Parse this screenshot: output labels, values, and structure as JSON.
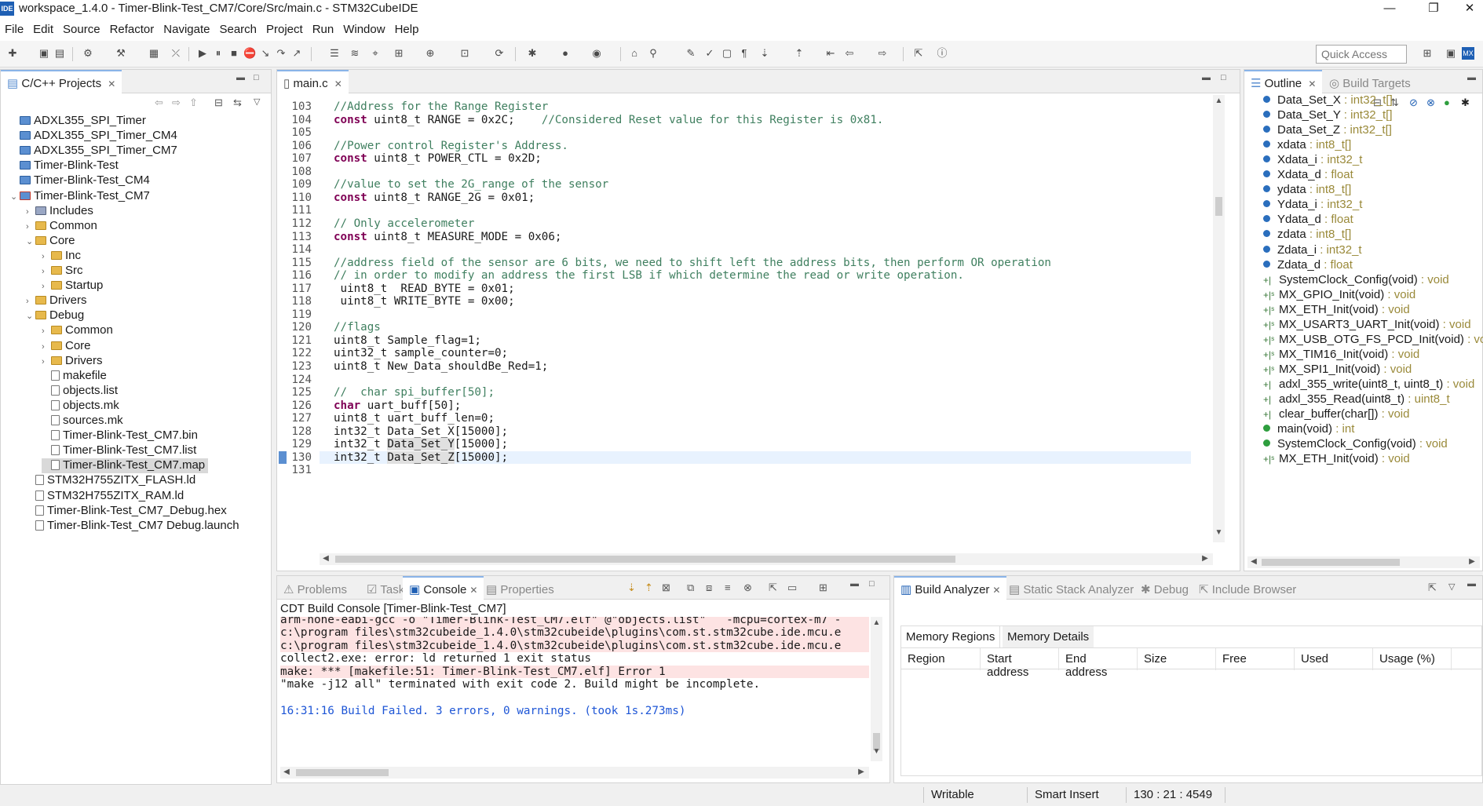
{
  "titlebar": {
    "app_icon": "IDE",
    "title": "workspace_1.4.0 - Timer-Blink-Test_CM7/Core/Src/main.c - STM32CubeIDE",
    "minimize": "—",
    "restore": "❐",
    "close": "✕"
  },
  "menu": [
    "File",
    "Edit",
    "Source",
    "Refactor",
    "Navigate",
    "Search",
    "Project",
    "Run",
    "Window",
    "Help"
  ],
  "toolbar": {
    "quick_access_placeholder": "Quick Access"
  },
  "projects_panel": {
    "tab_label": "C/C++ Projects",
    "tree": [
      {
        "label": "ADXL355_SPI_Timer",
        "icon": "project",
        "arrow": "",
        "indent": 0
      },
      {
        "label": "ADXL355_SPI_Timer_CM4",
        "icon": "project",
        "arrow": "",
        "indent": 0
      },
      {
        "label": "ADXL355_SPI_Timer_CM7",
        "icon": "project",
        "arrow": "",
        "indent": 0
      },
      {
        "label": "Timer-Blink-Test",
        "icon": "project",
        "arrow": "",
        "indent": 0
      },
      {
        "label": "Timer-Blink-Test_CM4",
        "icon": "project",
        "arrow": "",
        "indent": 0
      },
      {
        "label": "Timer-Blink-Test_CM7",
        "icon": "project-multi",
        "arrow": "v",
        "indent": 0
      },
      {
        "label": "Includes",
        "icon": "includes",
        "arrow": ">",
        "indent": 1
      },
      {
        "label": "Common",
        "icon": "folder",
        "arrow": ">",
        "indent": 1
      },
      {
        "label": "Core",
        "icon": "folder",
        "arrow": "v",
        "indent": 1
      },
      {
        "label": "Inc",
        "icon": "folder",
        "arrow": ">",
        "indent": 2
      },
      {
        "label": "Src",
        "icon": "folder",
        "arrow": ">",
        "indent": 2
      },
      {
        "label": "Startup",
        "icon": "folder",
        "arrow": ">",
        "indent": 2
      },
      {
        "label": "Drivers",
        "icon": "folder",
        "arrow": ">",
        "indent": 1
      },
      {
        "label": "Debug",
        "icon": "folder",
        "arrow": "v",
        "indent": 1
      },
      {
        "label": "Common",
        "icon": "folder",
        "arrow": ">",
        "indent": 2
      },
      {
        "label": "Core",
        "icon": "folder",
        "arrow": ">",
        "indent": 2
      },
      {
        "label": "Drivers",
        "icon": "folder",
        "arrow": ">",
        "indent": 2
      },
      {
        "label": "makefile",
        "icon": "file",
        "arrow": "",
        "indent": 2
      },
      {
        "label": "objects.list",
        "icon": "file",
        "arrow": "",
        "indent": 2
      },
      {
        "label": "objects.mk",
        "icon": "file",
        "arrow": "",
        "indent": 2
      },
      {
        "label": "sources.mk",
        "icon": "file",
        "arrow": "",
        "indent": 2
      },
      {
        "label": "Timer-Blink-Test_CM7.bin",
        "icon": "file",
        "arrow": "",
        "indent": 2
      },
      {
        "label": "Timer-Blink-Test_CM7.list",
        "icon": "file",
        "arrow": "",
        "indent": 2
      },
      {
        "label": "Timer-Blink-Test_CM7.map",
        "icon": "file",
        "arrow": "",
        "indent": 2,
        "selected": true
      },
      {
        "label": "STM32H755ZITX_FLASH.ld",
        "icon": "file",
        "arrow": "",
        "indent": 1
      },
      {
        "label": "STM32H755ZITX_RAM.ld",
        "icon": "file",
        "arrow": "",
        "indent": 1
      },
      {
        "label": "Timer-Blink-Test_CM7_Debug.hex",
        "icon": "file",
        "arrow": "",
        "indent": 1
      },
      {
        "label": "Timer-Blink-Test_CM7 Debug.launch",
        "icon": "file",
        "arrow": "",
        "indent": 1
      }
    ]
  },
  "editor": {
    "tab_label": "main.c",
    "lines": [
      {
        "n": "103",
        "t": "//Address for the Range Register",
        "k": "c"
      },
      {
        "n": "104",
        "pre": "const",
        "t": " uint8_t RANGE = 0x2C;    ",
        "post": "//Considered Reset value for this Register is 0x81.",
        "k": "kc"
      },
      {
        "n": "105",
        "t": "",
        "k": "p"
      },
      {
        "n": "106",
        "t": "//Power control Register's Address.",
        "k": "c"
      },
      {
        "n": "107",
        "pre": "const",
        "t": " uint8_t POWER_CTL = 0x2D;",
        "k": "k"
      },
      {
        "n": "108",
        "t": "",
        "k": "p"
      },
      {
        "n": "109",
        "t": "//value to set the 2G_range of the sensor",
        "k": "c"
      },
      {
        "n": "110",
        "pre": "const",
        "t": " uint8_t RANGE_2G = 0x01;",
        "k": "k"
      },
      {
        "n": "111",
        "t": "",
        "k": "p"
      },
      {
        "n": "112",
        "t": "// Only accelerometer",
        "k": "c"
      },
      {
        "n": "113",
        "pre": "const",
        "t": " uint8_t MEASURE_MODE = 0x06;",
        "k": "k"
      },
      {
        "n": "114",
        "t": "",
        "k": "p"
      },
      {
        "n": "115",
        "t": "//address field of the sensor are 6 bits, we need to shift left the address bits, then perform OR operation",
        "k": "c"
      },
      {
        "n": "116",
        "t": "// in order to modify an address the first LSB if which determine the read or write operation.",
        "k": "c"
      },
      {
        "n": "117",
        "t": " uint8_t  READ_BYTE = 0x01;",
        "k": "p"
      },
      {
        "n": "118",
        "t": " uint8_t WRITE_BYTE = 0x00;",
        "k": "p"
      },
      {
        "n": "119",
        "t": "",
        "k": "p"
      },
      {
        "n": "120",
        "t": "//flags",
        "k": "c"
      },
      {
        "n": "121",
        "t": "uint8_t Sample_flag=1;",
        "k": "p"
      },
      {
        "n": "122",
        "t": "uint32_t sample_counter=0;",
        "k": "p"
      },
      {
        "n": "123",
        "t": "uint8_t New_Data_shouldBe_Red=1;",
        "k": "p"
      },
      {
        "n": "124",
        "t": "",
        "k": "p"
      },
      {
        "n": "125",
        "t": "//  char spi_buffer[50];",
        "k": "c"
      },
      {
        "n": "126",
        "pre": "char",
        "t": " uart_buff[50];",
        "k": "k"
      },
      {
        "n": "127",
        "t": "uint8_t uart_buff_len=0;",
        "k": "p"
      },
      {
        "n": "128",
        "t": "int32_t Data_Set_X[15000];",
        "k": "p"
      },
      {
        "n": "129",
        "t": "int32_t ",
        "hl": "Data_Set_Y",
        "post": "[15000];",
        "k": "h"
      },
      {
        "n": "130",
        "t": "int32_t ",
        "hl": "Data_Set_Z",
        "post": "[15000];",
        "k": "h",
        "current": true
      },
      {
        "n": "131",
        "t": "",
        "k": "p"
      }
    ]
  },
  "outline": {
    "tab_label": "Outline",
    "tab2_label": "Build Targets",
    "items": [
      {
        "name": "Data_Set_X",
        "type": " : int32_t[]",
        "kind": "var"
      },
      {
        "name": "Data_Set_Y",
        "type": " : int32_t[]",
        "kind": "var"
      },
      {
        "name": "Data_Set_Z",
        "type": " : int32_t[]",
        "kind": "var"
      },
      {
        "name": "xdata",
        "type": " : int8_t[]",
        "kind": "var"
      },
      {
        "name": "Xdata_i",
        "type": " : int32_t",
        "kind": "var"
      },
      {
        "name": "Xdata_d",
        "type": " : float",
        "kind": "var"
      },
      {
        "name": "ydata",
        "type": " : int8_t[]",
        "kind": "var"
      },
      {
        "name": "Ydata_i",
        "type": " : int32_t",
        "kind": "var"
      },
      {
        "name": "Ydata_d",
        "type": " : float",
        "kind": "var"
      },
      {
        "name": "zdata",
        "type": " : int8_t[]",
        "kind": "var"
      },
      {
        "name": "Zdata_i",
        "type": " : int32_t",
        "kind": "var"
      },
      {
        "name": "Zdata_d",
        "type": " : float",
        "kind": "var"
      },
      {
        "name": "SystemClock_Config(void)",
        "type": " : void",
        "kind": "decl"
      },
      {
        "name": "MX_GPIO_Init(void)",
        "type": " : void",
        "kind": "static"
      },
      {
        "name": "MX_ETH_Init(void)",
        "type": " : void",
        "kind": "static"
      },
      {
        "name": "MX_USART3_UART_Init(void)",
        "type": " : void",
        "kind": "static"
      },
      {
        "name": "MX_USB_OTG_FS_PCD_Init(void)",
        "type": " : void",
        "kind": "static"
      },
      {
        "name": "MX_TIM16_Init(void)",
        "type": " : void",
        "kind": "static"
      },
      {
        "name": "MX_SPI1_Init(void)",
        "type": " : void",
        "kind": "static"
      },
      {
        "name": "adxl_355_write(uint8_t, uint8_t)",
        "type": " : void",
        "kind": "decl"
      },
      {
        "name": "adxl_355_Read(uint8_t)",
        "type": " : uint8_t",
        "kind": "decl"
      },
      {
        "name": "clear_buffer(char[])",
        "type": " : void",
        "kind": "decl"
      },
      {
        "name": "main(void)",
        "type": " : int",
        "kind": "func"
      },
      {
        "name": "SystemClock_Config(void)",
        "type": " : void",
        "kind": "func"
      },
      {
        "name": "MX_ETH_Init(void)",
        "type": " : void",
        "kind": "static"
      }
    ]
  },
  "console_panel": {
    "tabs": [
      "Problems",
      "Tasks",
      "Console",
      "Properties"
    ],
    "title": "CDT Build Console [Timer-Blink-Test_CM7]",
    "lines": [
      {
        "t": "arm-none-eabi-gcc -o \"Timer-Blink-Test_CM7.elf\" @\"objects.list\"   -mcpu=cortex-m7 -",
        "k": "err"
      },
      {
        "t": "c:\\program files\\stm32cubeide_1.4.0\\stm32cubeide\\plugins\\com.st.stm32cube.ide.mcu.e",
        "k": "err"
      },
      {
        "t": "c:\\program files\\stm32cubeide_1.4.0\\stm32cubeide\\plugins\\com.st.stm32cube.ide.mcu.e",
        "k": "err"
      },
      {
        "t": "collect2.exe: error: ld returned 1 exit status",
        "k": "plain"
      },
      {
        "t": "make: *** [makefile:51: Timer-Blink-Test_CM7.elf] Error 1",
        "k": "err"
      },
      {
        "t": "\"make -j12 all\" terminated with exit code 2. Build might be incomplete.",
        "k": "plain"
      },
      {
        "t": "",
        "k": "plain"
      },
      {
        "t": "16:31:16 Build Failed. 3 errors, 0 warnings. (took 1s.273ms)",
        "k": "info"
      }
    ]
  },
  "build_analyzer": {
    "tabs": [
      "Build Analyzer",
      "Static Stack Analyzer",
      "Debug",
      "Include Browser"
    ],
    "subtabs": [
      "Memory Regions",
      "Memory Details"
    ],
    "columns": [
      "Region",
      "Start address",
      "End address",
      "Size",
      "Free",
      "Used",
      "Usage (%)"
    ]
  },
  "statusbar": {
    "writable": "Writable",
    "insert_mode": "Smart Insert",
    "position": "130 : 21 : 4549"
  }
}
